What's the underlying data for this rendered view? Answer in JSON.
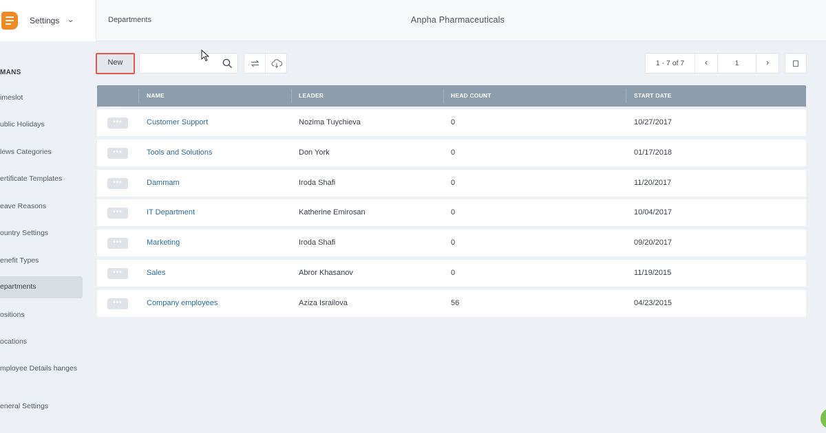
{
  "header": {
    "settings_label": "Settings",
    "breadcrumb": "Departments",
    "company": "Anpha Pharmaceuticals"
  },
  "sidebar": {
    "title": "MANS",
    "items": [
      {
        "label": "imeslot"
      },
      {
        "label": "ublic Holidays"
      },
      {
        "label": "lews Categories"
      },
      {
        "label": "ertificate Templates"
      },
      {
        "label": "eave Reasons"
      },
      {
        "label": "ountry Settings"
      },
      {
        "label": "enefit Types"
      },
      {
        "label": "epartments",
        "active": true
      },
      {
        "label": "ositions"
      },
      {
        "label": "ocations"
      },
      {
        "label": "mployee Details hanges"
      },
      {
        "label": "eneral Settings"
      }
    ]
  },
  "toolbar": {
    "new_label": "New",
    "search_placeholder": "",
    "pager_range": "1 - 7 of 7",
    "page_number": "1"
  },
  "table": {
    "columns": [
      "NAME",
      "LEADER",
      "HEAD COUNT",
      "START DATE"
    ],
    "rows": [
      {
        "name": "Customer Support",
        "leader": "Nozima Tuychieva",
        "head_count": "0",
        "start_date": "10/27/2017"
      },
      {
        "name": "Tools and Solutions",
        "leader": "Don York",
        "head_count": "0",
        "start_date": "01/17/2018"
      },
      {
        "name": "Dammam",
        "leader": "Iroda Shafi",
        "head_count": "0",
        "start_date": "11/20/2017"
      },
      {
        "name": "IT Department",
        "leader": "Katherine Emirosan",
        "head_count": "0",
        "start_date": "10/04/2017"
      },
      {
        "name": "Marketing",
        "leader": "Iroda Shafi",
        "head_count": "0",
        "start_date": "09/20/2017"
      },
      {
        "name": "Sales",
        "leader": "Abror Khasanov",
        "head_count": "0",
        "start_date": "11/19/2015"
      },
      {
        "name": "Company employees",
        "leader": "Aziza Israilova",
        "head_count": "56",
        "start_date": "04/23/2015"
      }
    ]
  },
  "colors": {
    "accent": "#f08a24",
    "table_header": "#8e9dac",
    "link": "#2e6b9e",
    "highlight_border": "#e2574c"
  }
}
